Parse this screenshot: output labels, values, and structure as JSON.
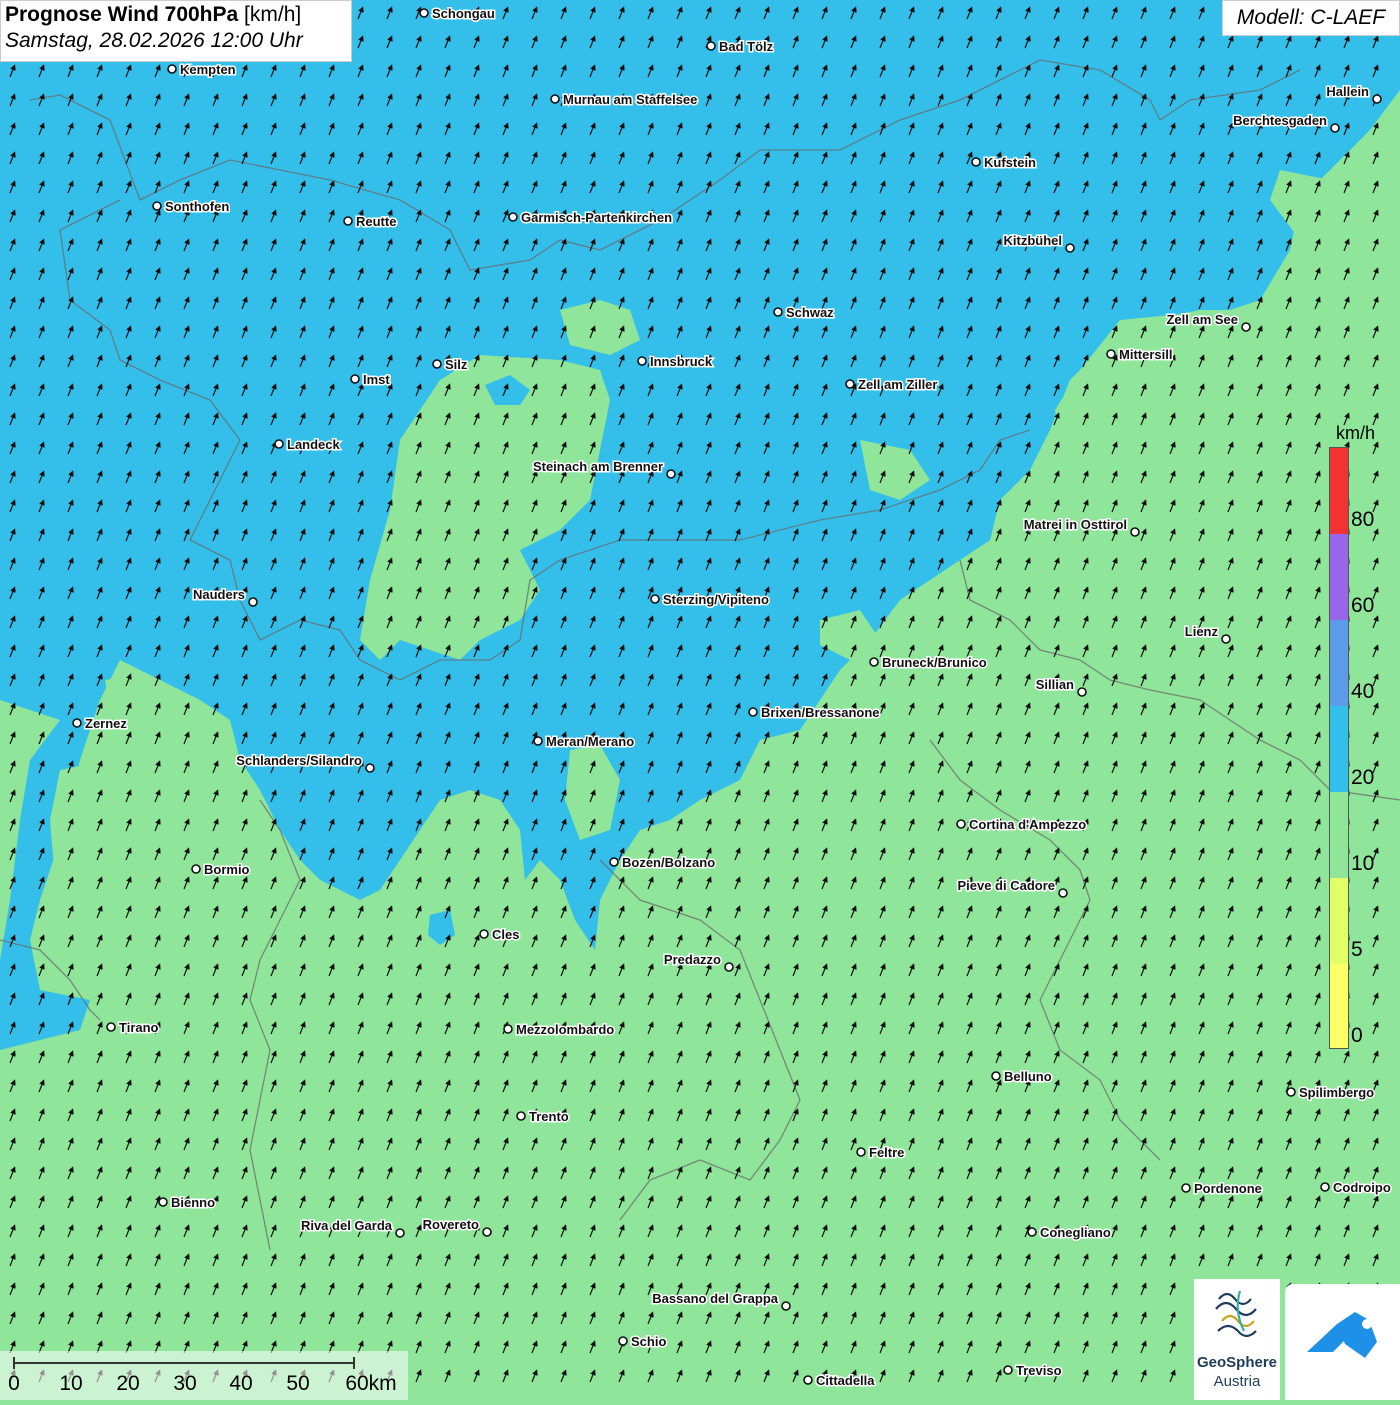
{
  "header": {
    "title_bold": "Prognose Wind 700hPa",
    "title_unit": "[km/h]",
    "datetime": "Samstag, 28.02.2026 12:00 Uhr",
    "model": "Modell: C-LAEF"
  },
  "legend": {
    "unit": "km/h",
    "labels": [
      "80",
      "60",
      "40",
      "20",
      "10",
      "5",
      "0"
    ],
    "colors": {
      "0_5": "#ffff66",
      "5_10": "#e2ff66",
      "10_20": "#8fe59a",
      "20_40": "#33bfea",
      "40_60": "#5b9bea",
      "60_80": "#9966ea",
      "80_plus": "#f23333"
    }
  },
  "scale": {
    "labels": [
      "0",
      "10",
      "20",
      "30",
      "40",
      "50",
      "60km"
    ]
  },
  "wind": {
    "direction": "from south-southwest",
    "arrow_icon": "wind-arrow-icon"
  },
  "cities": [
    {
      "name": "Schongau"
    },
    {
      "name": "Bad Tölz"
    },
    {
      "name": "Kempten"
    },
    {
      "name": "Murnau am Staffelsee"
    },
    {
      "name": "Hallein"
    },
    {
      "name": "Berchtesgaden"
    },
    {
      "name": "Kufstein"
    },
    {
      "name": "Sonthofen"
    },
    {
      "name": "Reutte"
    },
    {
      "name": "Garmisch-Partenkirchen"
    },
    {
      "name": "Kitzbühel"
    },
    {
      "name": "Schwaz"
    },
    {
      "name": "Zell am See"
    },
    {
      "name": "Mittersill"
    },
    {
      "name": "Silz"
    },
    {
      "name": "Innsbruck"
    },
    {
      "name": "Imst"
    },
    {
      "name": "Zell am Ziller"
    },
    {
      "name": "Landeck"
    },
    {
      "name": "Steinach am Brenner"
    },
    {
      "name": "Matrei in Osttirol"
    },
    {
      "name": "Nauders"
    },
    {
      "name": "Sterzing/Vipiteno"
    },
    {
      "name": "Lienz"
    },
    {
      "name": "Bruneck/Brunico"
    },
    {
      "name": "Sillian"
    },
    {
      "name": "Zernez"
    },
    {
      "name": "Brixen/Bressanone"
    },
    {
      "name": "Meran/Merano"
    },
    {
      "name": "Schlanders/Silandro"
    },
    {
      "name": "Cortina d'Ampezzo"
    },
    {
      "name": "Bozen/Bolzano"
    },
    {
      "name": "Bormio"
    },
    {
      "name": "Pieve di Cadore"
    },
    {
      "name": "Cles"
    },
    {
      "name": "Predazzo"
    },
    {
      "name": "Tirano"
    },
    {
      "name": "Mezzolombardo"
    },
    {
      "name": "Belluno"
    },
    {
      "name": "Spilimbergo"
    },
    {
      "name": "Trento"
    },
    {
      "name": "Feltre"
    },
    {
      "name": "Pordenone"
    },
    {
      "name": "Codroipo"
    },
    {
      "name": "Bienno"
    },
    {
      "name": "Riva del Garda"
    },
    {
      "name": "Rovereto"
    },
    {
      "name": "Conegliano"
    },
    {
      "name": "Bassano del Grappa"
    },
    {
      "name": "Schio"
    },
    {
      "name": "Treviso"
    },
    {
      "name": "Cittadella"
    }
  ],
  "logos": {
    "geosphere_line1": "GeoSphere",
    "geosphere_line2": "Austria"
  }
}
